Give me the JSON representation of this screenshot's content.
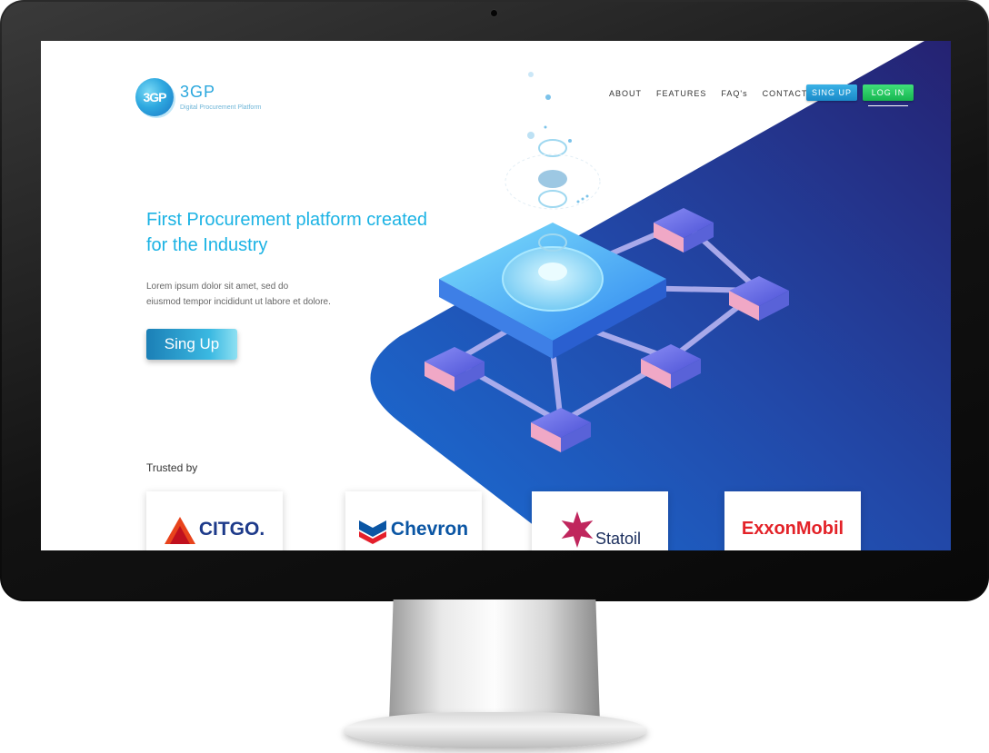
{
  "header": {
    "logo_badge": "3GP",
    "logo_title": "3GP",
    "logo_subtitle": "Digital Procurement Platform",
    "nav": [
      "ABOUT",
      "FEATURES",
      "FAQ's",
      "CONTACT"
    ],
    "signup_label": "SING UP",
    "login_label": "LOG IN"
  },
  "hero": {
    "title": "First Procurement platform created for the Industry",
    "body_line1": "Lorem ipsum dolor sit amet, sed do",
    "body_line2": "eiusmod tempor incididunt ut labore et dolore.",
    "cta_label": "Sing Up"
  },
  "trusted": {
    "label": "Trusted by",
    "brands": [
      "CITGO.",
      "Chevron",
      "Statoil",
      "ExxonMobil"
    ]
  },
  "colors": {
    "accent": "#1cb3e4",
    "banner_dark": "#232276",
    "banner_mid": "#1a5cc2",
    "login_green": "#22c55e"
  }
}
